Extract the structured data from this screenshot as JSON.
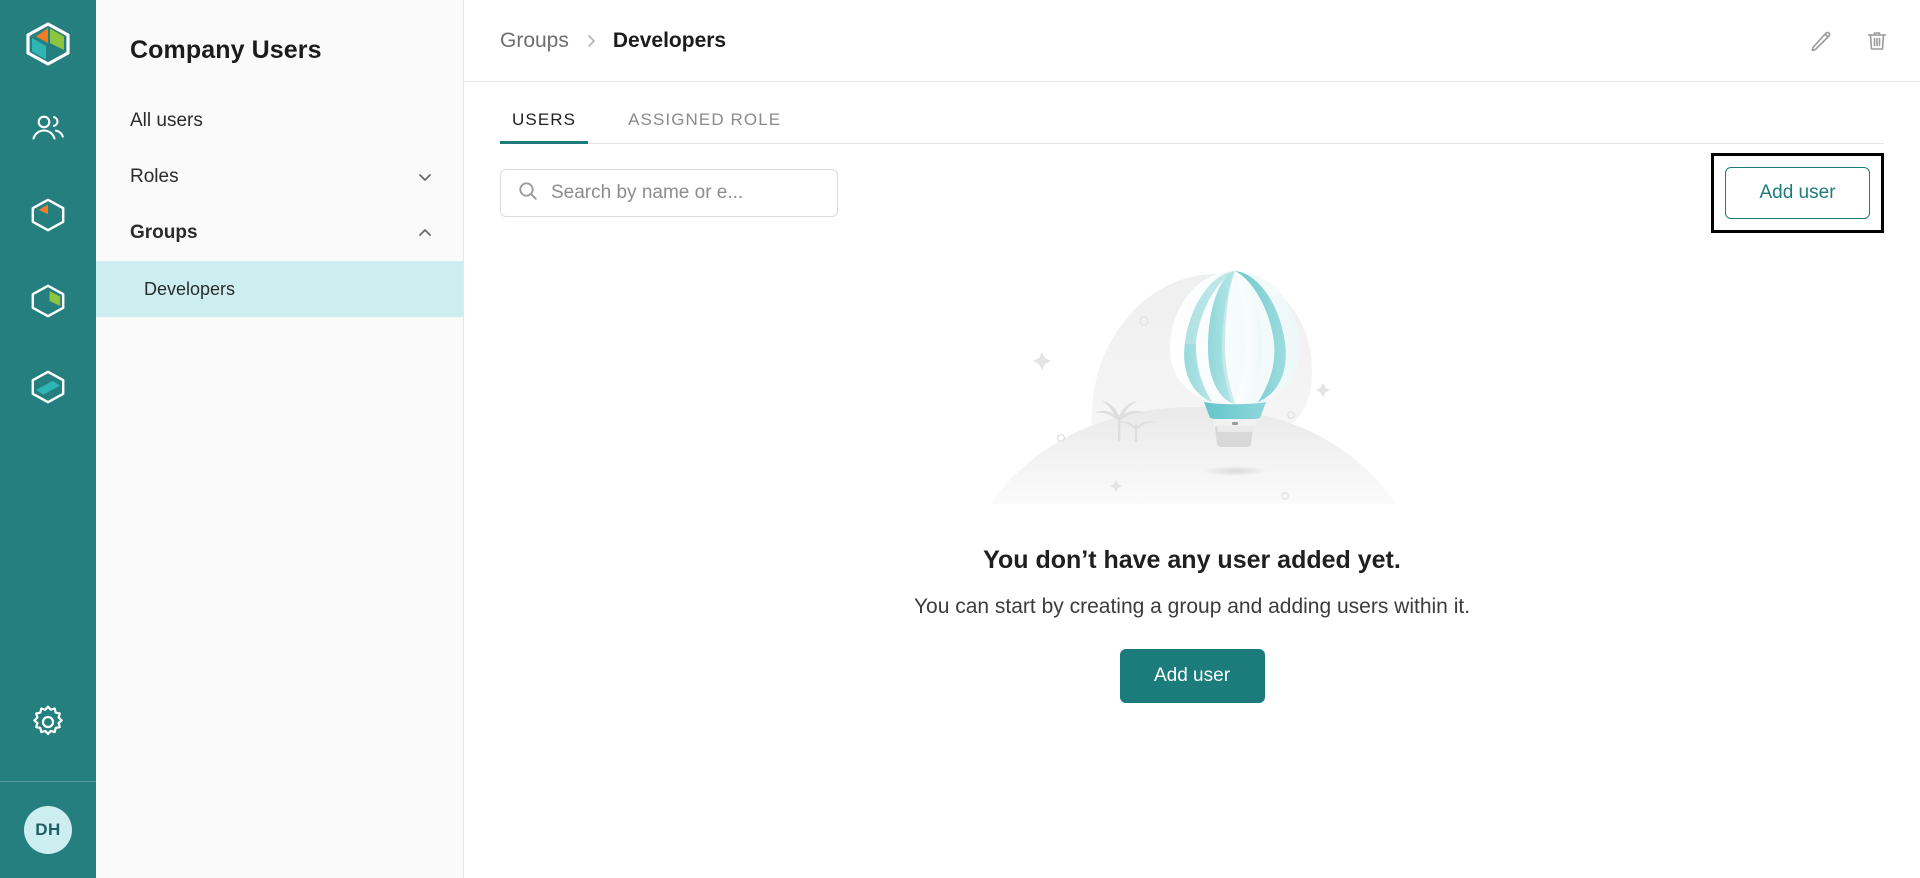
{
  "brand": {
    "logo_icon": "cube-hex-logo",
    "rail_color": "#257f7f",
    "accent_color": "#1c7b7b",
    "highlight_color": "#cdeef0"
  },
  "rail": {
    "items": [
      {
        "icon": "users-group-icon",
        "name": "rail-item-users"
      },
      {
        "icon": "hexagon-orange-wedge-icon",
        "name": "rail-item-products"
      },
      {
        "icon": "hexagon-green-wedge-icon",
        "name": "rail-item-analytics"
      },
      {
        "icon": "hexagon-teal-band-icon",
        "name": "rail-item-modules"
      }
    ],
    "settings_icon": "gear-icon",
    "avatar_initials": "DH"
  },
  "sidebar": {
    "title": "Company Users",
    "items": [
      {
        "label": "All users",
        "chevron": "",
        "bold": false,
        "sub": false,
        "active": false
      },
      {
        "label": "Roles",
        "chevron": "chevron-down-icon",
        "bold": false,
        "sub": false,
        "active": false
      },
      {
        "label": "Groups",
        "chevron": "chevron-up-icon",
        "bold": true,
        "sub": false,
        "active": false
      },
      {
        "label": "Developers",
        "chevron": "",
        "bold": false,
        "sub": true,
        "active": true
      }
    ]
  },
  "header": {
    "breadcrumb_parent": "Groups",
    "breadcrumb_separator": "›",
    "breadcrumb_current": "Developers",
    "edit_icon": "pencil-icon",
    "delete_icon": "trash-icon"
  },
  "tabs": [
    {
      "label": "USERS",
      "active": true
    },
    {
      "label": "ASSIGNED ROLE",
      "active": false
    }
  ],
  "toolbar": {
    "search_placeholder": "Search by name or e...",
    "search_value": "",
    "search_icon": "search-icon",
    "add_user_label": "Add user"
  },
  "empty_state": {
    "illustration": "hot-air-balloon-illustration",
    "title": "You don’t have any user added yet.",
    "subtitle": "You can start by creating a group and adding users within it.",
    "add_user_label": "Add user"
  }
}
